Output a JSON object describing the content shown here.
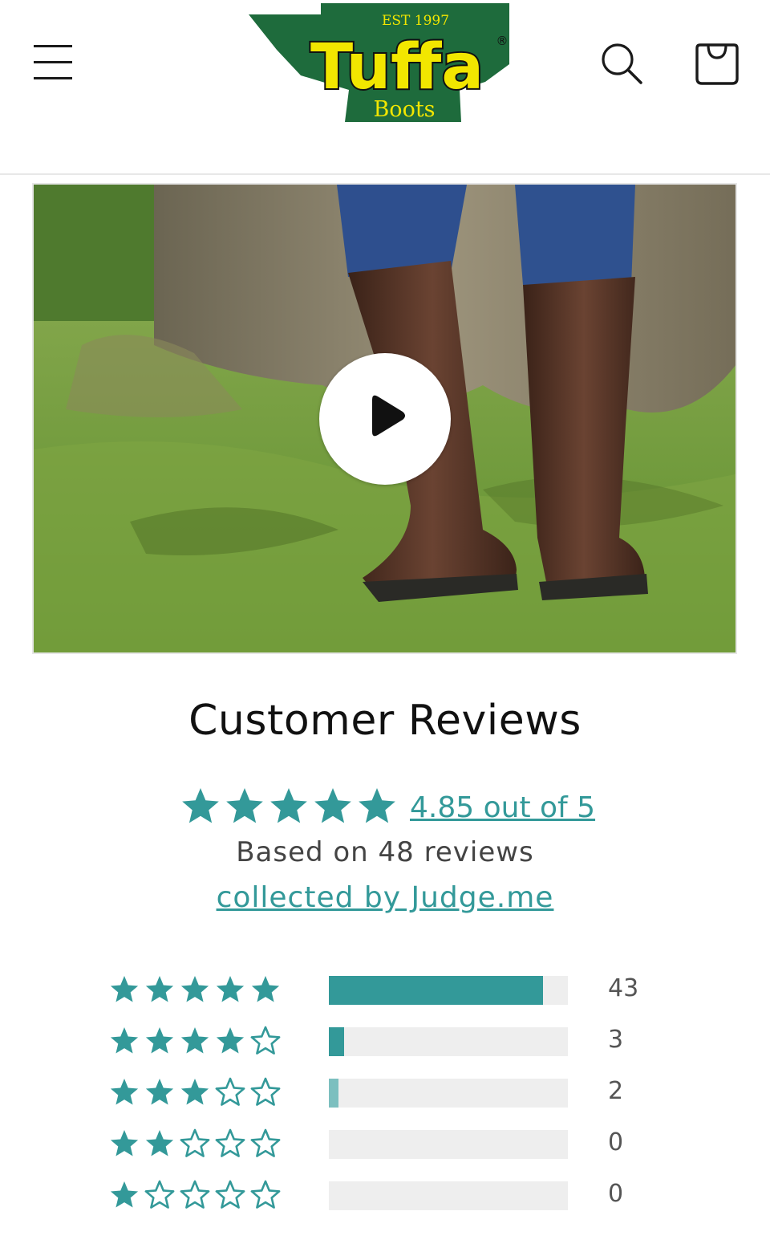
{
  "header": {
    "logo": {
      "est": "EST 1997",
      "brand": "Tuffa",
      "sub": "Boots",
      "mark": "®"
    },
    "icons": {
      "menu": "menu-icon",
      "search": "search-icon",
      "cart": "cart-icon"
    }
  },
  "video": {
    "play_icon": "play-icon"
  },
  "reviews": {
    "title": "Customer Reviews",
    "average": 4.85,
    "average_text": "4.85 out of 5",
    "based_on": "Based on 48 reviews",
    "collected_by": "collected by Judge.me",
    "histogram": [
      {
        "stars": 5,
        "count": "43",
        "fraction": 0.896
      },
      {
        "stars": 4,
        "count": "3",
        "fraction": 0.0625
      },
      {
        "stars": 3,
        "count": "2",
        "fraction": 0.0417
      },
      {
        "stars": 2,
        "count": "0",
        "fraction": 0
      },
      {
        "stars": 1,
        "count": "0",
        "fraction": 0
      }
    ]
  },
  "colors": {
    "accent": "#339999",
    "accent_light": "#7cbfbf",
    "track": "#eeeeee",
    "logo_green": "#1e6b3c",
    "logo_yellow": "#f2e600"
  }
}
